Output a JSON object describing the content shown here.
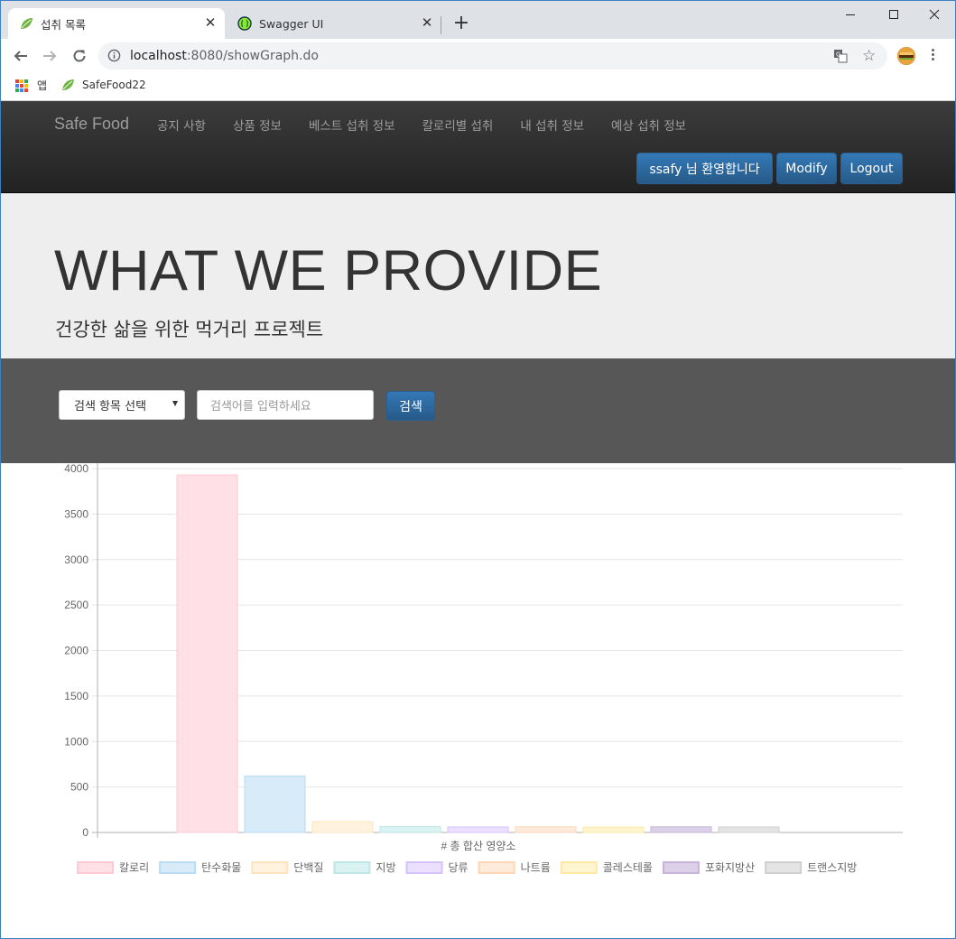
{
  "browser": {
    "tabs": [
      {
        "title": "섭취 목록",
        "active": true
      },
      {
        "title": "Swagger UI",
        "active": false
      }
    ],
    "url_host": "localhost",
    "url_rest": ":8080/showGraph.do",
    "bookmarks": [
      {
        "label": "앱",
        "icon": "apps-grid-icon"
      },
      {
        "label": "SafeFood22",
        "icon": "leaf-icon"
      }
    ]
  },
  "navbar": {
    "brand": "Safe Food",
    "links": [
      "공지 사항",
      "상품 정보",
      "베스트 섭취 정보",
      "칼로리별 섭취",
      "내 섭취 정보",
      "예상 섭취 정보"
    ],
    "welcome": "ssafy 님 환영합니다",
    "modify": "Modify",
    "logout": "Logout"
  },
  "jumbotron": {
    "title": "WHAT WE PROVIDE",
    "subtitle": "건강한 삶을 위한 먹거리 프로젝트"
  },
  "search": {
    "select_label": "검색 항목 선택",
    "input_placeholder": "검색어를 입력하세요",
    "button": "검색"
  },
  "chart_data": {
    "type": "bar",
    "xlabel": "# 총 합산 영양소",
    "ylim": [
      0,
      4000
    ],
    "yticks": [
      0,
      500,
      1000,
      1500,
      2000,
      2500,
      3000,
      3500,
      4000
    ],
    "grid": true,
    "legend_position": "bottom",
    "series": [
      {
        "name": "칼로리",
        "value": 3930,
        "color": "#ffe0e6",
        "border": "#ffc9d4"
      },
      {
        "name": "탄수화물",
        "value": 620,
        "color": "#d7ebf9",
        "border": "#b9dbf3"
      },
      {
        "name": "단백질",
        "value": 120,
        "color": "#fff3e0",
        "border": "#ffe3bd"
      },
      {
        "name": "지방",
        "value": 65,
        "color": "#dbf2f2",
        "border": "#bfe6e6"
      },
      {
        "name": "당류",
        "value": 60,
        "color": "#ebe0ff",
        "border": "#d5c2fb"
      },
      {
        "name": "나트륨",
        "value": 62,
        "color": "#ffebdb",
        "border": "#ffd6b5"
      },
      {
        "name": "콜레스테롤",
        "value": 58,
        "color": "#fff5d1",
        "border": "#ffe8a0"
      },
      {
        "name": "포화지방산",
        "value": 62,
        "color": "#dcd0e8",
        "border": "#c6b5d9"
      },
      {
        "name": "트랜스지방",
        "value": 60,
        "color": "#e4e4e4",
        "border": "#cfcfcf"
      }
    ]
  }
}
